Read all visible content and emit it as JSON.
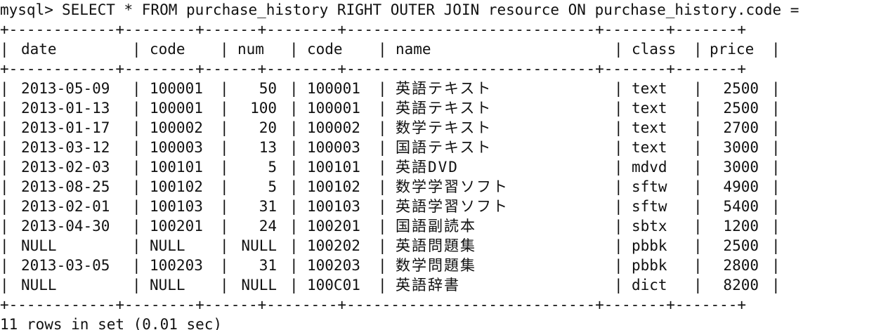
{
  "terminal": {
    "prompt": "mysql>",
    "command": "SELECT * FROM purchase_history RIGHT OUTER JOIN resource ON purchase_history.code =",
    "border": "+------------+--------+------+--------+----------------------------+-------+-------+",
    "columns": [
      "date",
      "code",
      "num",
      "code",
      "name",
      "class",
      "price"
    ],
    "rows": [
      [
        "2013-05-09",
        "100001",
        "50",
        "100001",
        "英語テキスト",
        "text",
        "2500"
      ],
      [
        "2013-01-13",
        "100001",
        "100",
        "100001",
        "英語テキスト",
        "text",
        "2500"
      ],
      [
        "2013-01-17",
        "100002",
        "20",
        "100002",
        "数学テキスト",
        "text",
        "2700"
      ],
      [
        "2013-03-12",
        "100003",
        "13",
        "100003",
        "国語テキスト",
        "text",
        "3000"
      ],
      [
        "2013-02-03",
        "100101",
        "5",
        "100101",
        "英語DVD",
        "mdvd",
        "3000"
      ],
      [
        "2013-08-25",
        "100102",
        "5",
        "100102",
        "数学学習ソフト",
        "sftw",
        "4900"
      ],
      [
        "2013-02-01",
        "100103",
        "31",
        "100103",
        "英語学習ソフト",
        "sftw",
        "5400"
      ],
      [
        "2013-04-30",
        "100201",
        "24",
        "100201",
        "国語副読本",
        "sbtx",
        "1200"
      ],
      [
        "NULL",
        "NULL",
        "NULL",
        "100202",
        "英語問題集",
        "pbbk",
        "2500"
      ],
      [
        "2013-03-05",
        "100203",
        "31",
        "100203",
        "数学問題集",
        "pbbk",
        "2800"
      ],
      [
        "NULL",
        "NULL",
        "NULL",
        "100C01",
        "英語辞書",
        "dict",
        "8200"
      ]
    ],
    "footer": "11 rows in set (0.01 sec)"
  }
}
